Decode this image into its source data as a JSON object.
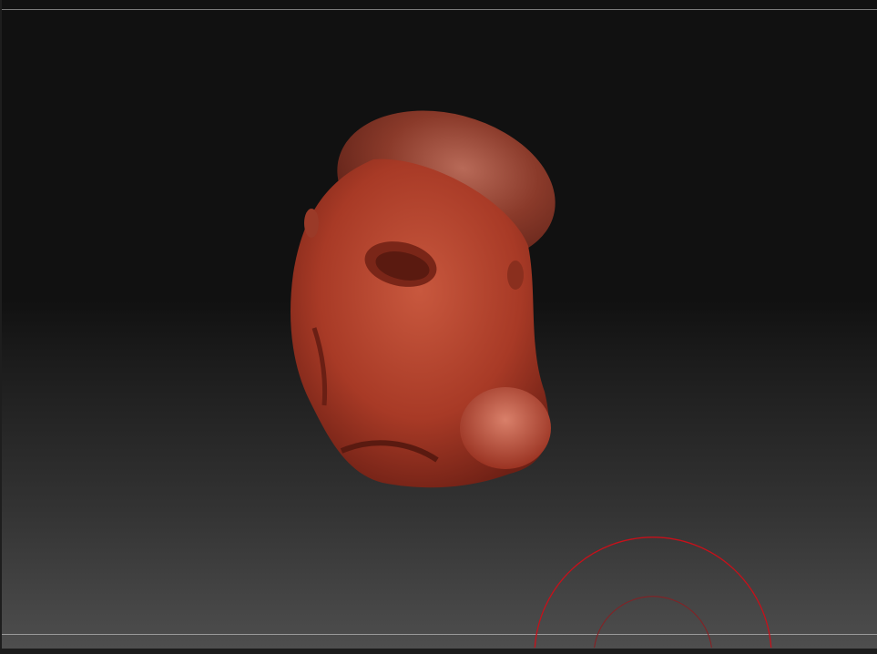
{
  "viewport": {
    "model": "sculpted-head-mesh",
    "material_color": "#b5442d",
    "background_top": "#111111",
    "background_bottom": "#4e4e4e"
  },
  "brush_cursor": {
    "outer_color": "#c8101a",
    "inner_color": "#8a1e22"
  }
}
